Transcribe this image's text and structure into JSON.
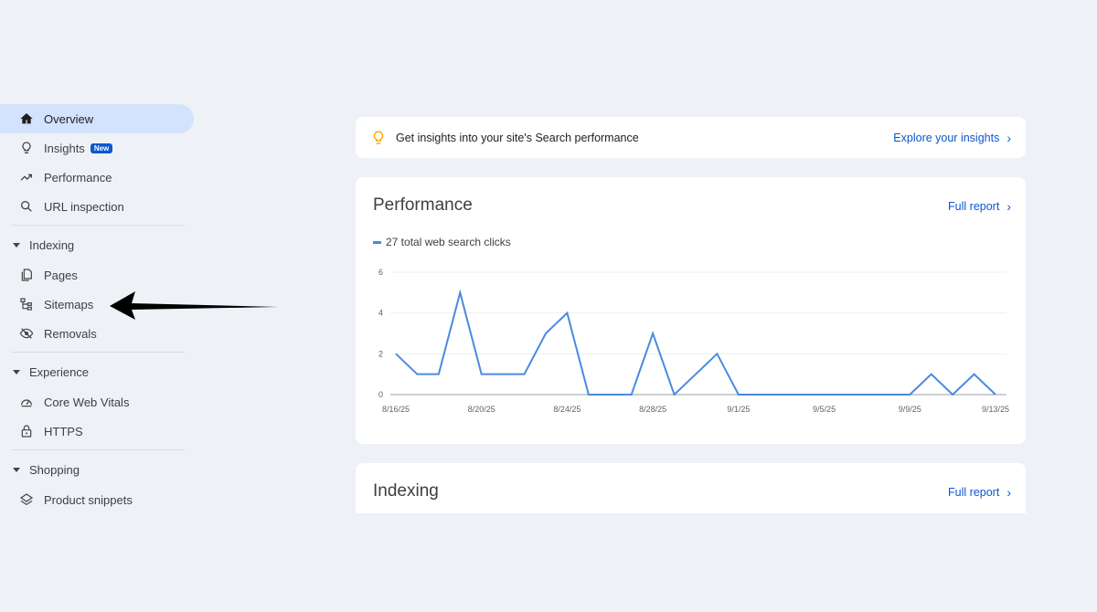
{
  "sidebar": {
    "items": [
      {
        "label": "Overview",
        "icon": "home-icon"
      },
      {
        "label": "Insights",
        "icon": "lightbulb-icon",
        "badge": "New"
      },
      {
        "label": "Performance",
        "icon": "trending-up-icon"
      },
      {
        "label": "URL inspection",
        "icon": "search-icon"
      }
    ],
    "indexing": {
      "label": "Indexing",
      "items": [
        {
          "label": "Pages",
          "icon": "pages-icon"
        },
        {
          "label": "Sitemaps",
          "icon": "sitemap-icon"
        },
        {
          "label": "Removals",
          "icon": "eye-off-icon"
        }
      ]
    },
    "experience": {
      "label": "Experience",
      "items": [
        {
          "label": "Core Web Vitals",
          "icon": "speedometer-icon"
        },
        {
          "label": "HTTPS",
          "icon": "lock-icon"
        }
      ]
    },
    "shopping": {
      "label": "Shopping",
      "items": [
        {
          "label": "Product snippets",
          "icon": "layers-icon"
        }
      ]
    }
  },
  "insight_banner": {
    "text": "Get insights into your site's Search performance",
    "link": "Explore your insights"
  },
  "performance": {
    "title": "Performance",
    "link": "Full report",
    "legend": "27 total web search clicks"
  },
  "indexing_card": {
    "title": "Indexing",
    "link": "Full report"
  },
  "colors": {
    "accent": "#0b57d0",
    "active_bg": "#d3e3fd",
    "line": "#4a8ae0",
    "bulb": "#f9ab00"
  },
  "chart_data": {
    "type": "line",
    "x": [
      "8/16/25",
      "8/17/25",
      "8/18/25",
      "8/19/25",
      "8/20/25",
      "8/21/25",
      "8/22/25",
      "8/23/25",
      "8/24/25",
      "8/25/25",
      "8/26/25",
      "8/27/25",
      "8/28/25",
      "8/29/25",
      "8/30/25",
      "8/31/25",
      "9/1/25",
      "9/2/25",
      "9/3/25",
      "9/4/25",
      "9/5/25",
      "9/6/25",
      "9/7/25",
      "9/8/25",
      "9/9/25",
      "9/10/25",
      "9/11/25",
      "9/12/25",
      "9/13/25"
    ],
    "series": [
      {
        "name": "27 total web search clicks",
        "values": [
          2,
          1,
          1,
          5,
          1,
          1,
          1,
          3,
          4,
          0,
          0,
          0,
          3,
          0,
          1,
          2,
          0,
          0,
          0,
          0,
          0,
          0,
          0,
          0,
          0,
          1,
          0,
          1,
          0
        ]
      }
    ],
    "x_tick_labels": [
      "8/16/25",
      "8/20/25",
      "8/24/25",
      "8/28/25",
      "9/1/25",
      "9/5/25",
      "9/9/25",
      "9/13/25"
    ],
    "y_ticks": [
      "0",
      "2",
      "4",
      "6"
    ],
    "ylim": [
      0,
      6
    ],
    "grid": true
  }
}
